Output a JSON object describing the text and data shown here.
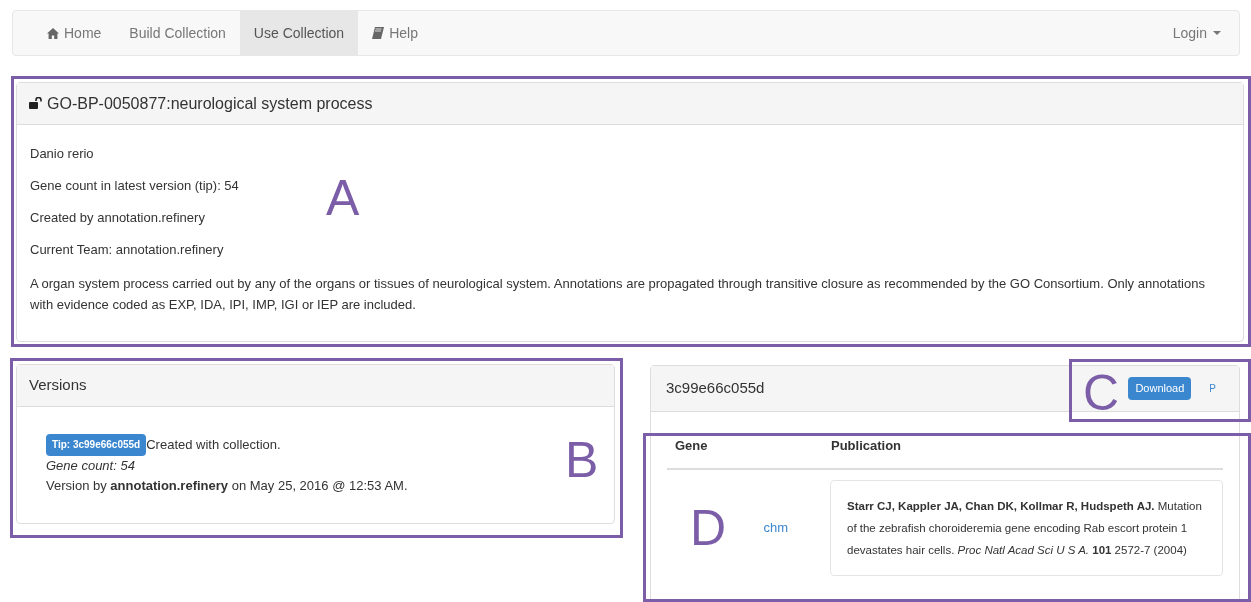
{
  "navbar": {
    "items": [
      {
        "label": "Home",
        "selected": false
      },
      {
        "label": "Build Collection",
        "selected": false
      },
      {
        "label": "Use Collection",
        "selected": true
      },
      {
        "label": "Help",
        "selected": false
      }
    ],
    "login": "Login"
  },
  "collection": {
    "title": "GO-BP-0050877:neurological system process",
    "lines": [
      "Danio rerio",
      "Gene count in latest version (tip): 54",
      "Created by annotation.refinery",
      "Current Team: annotation.refinery"
    ],
    "description": "A organ system process carried out by any of the organs or tissues of neurological system. Annotations are propagated through transitive closure as recommended by the GO Consortium. Only annotations with evidence coded as EXP, IDA, IPI, IMP, IGI or IEP are included."
  },
  "versions": {
    "title": "Versions",
    "badge": "Tip: 3c99e66c055d",
    "note": "Created with collection.",
    "gene_count": "Gene count: 54",
    "version_by": "Version by **annotation.refinery** on May 25, 2016 @ 12:53 AM."
  },
  "version_panel": {
    "title": "3c99e66c055d",
    "download": "Download",
    "extra": "P",
    "table": {
      "columns": [
        "Gene",
        "Publication"
      ],
      "rows": [
        {
          "gene": "chm",
          "publication": "**Starr CJ, Kappler JA, Chan DK, Kollmar R, Hudspeth AJ.** Mutation of the zebrafish choroideremia gene encoding Rab escort protein 1 devastates hair cells. *Proc Natl Acad Sci U S A.* **101** 2572-7 (2004)"
        }
      ]
    }
  },
  "annotations": [
    "A",
    "B",
    "C",
    "D"
  ]
}
